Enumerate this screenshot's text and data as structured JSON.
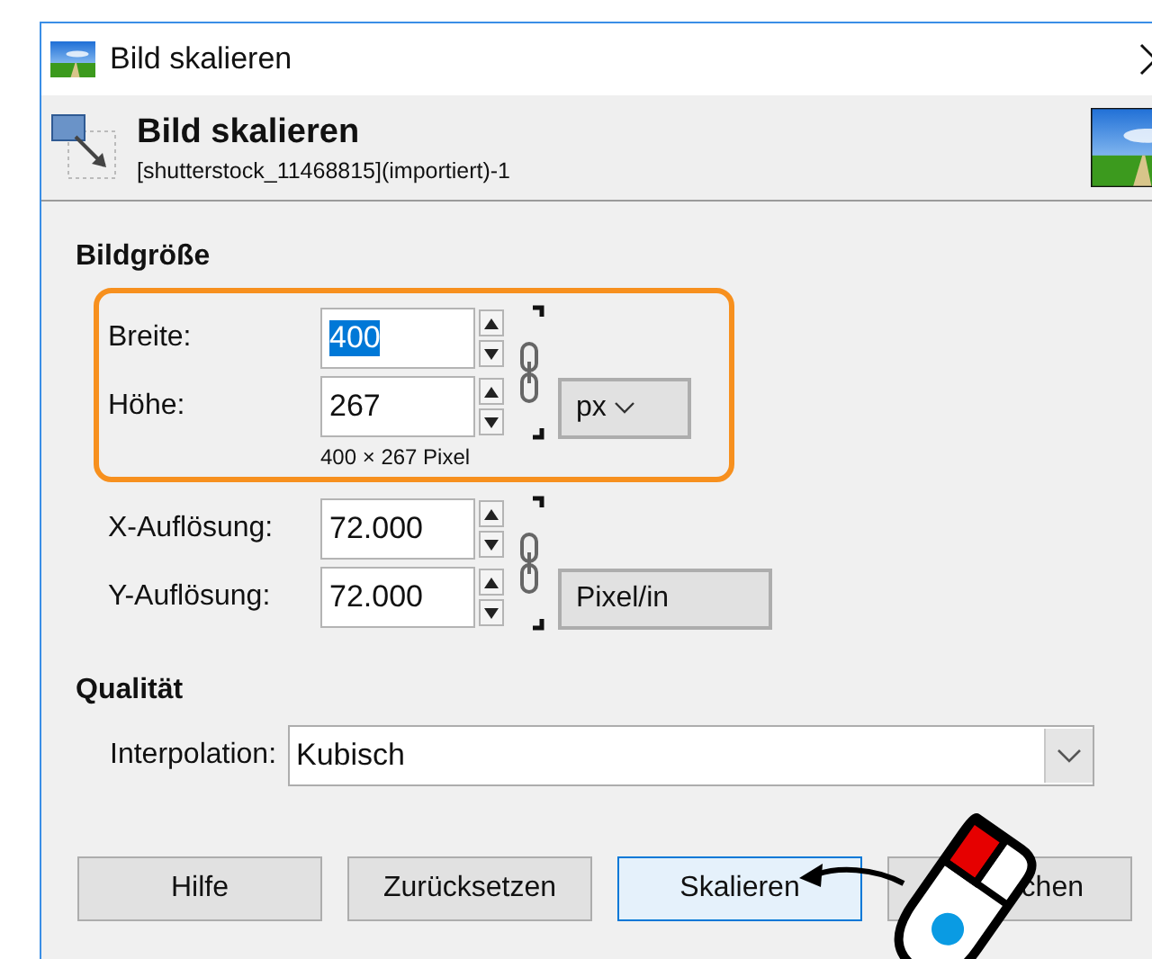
{
  "window": {
    "title": "Bild skalieren"
  },
  "header": {
    "title": "Bild skalieren",
    "subtitle": "[shutterstock_11468815](importiert)-1"
  },
  "image_size": {
    "heading": "Bildgröße",
    "highlighted": true,
    "fields": [
      {
        "label": "Breite:",
        "value": "400",
        "text_selected": true
      },
      {
        "label": "Höhe:",
        "value": "267",
        "text_selected": false
      }
    ],
    "unit": "px",
    "summary": "400 × 267 Pixel"
  },
  "resolution": {
    "fields": [
      {
        "label": "X-Auflösung:",
        "value": "72.000",
        "text_selected": false
      },
      {
        "label": "Y-Auflösung:",
        "value": "72.000",
        "text_selected": false
      }
    ],
    "unit": "Pixel/in"
  },
  "quality": {
    "heading": "Qualität",
    "interpolation": {
      "label": "Interpolation:",
      "value": "Kubisch"
    }
  },
  "buttons": [
    {
      "label": "Hilfe",
      "focused": false
    },
    {
      "label": "Zurücksetzen",
      "focused": false
    },
    {
      "label": "Skalieren",
      "focused": true
    },
    {
      "label": "chen",
      "focused": false
    }
  ]
}
